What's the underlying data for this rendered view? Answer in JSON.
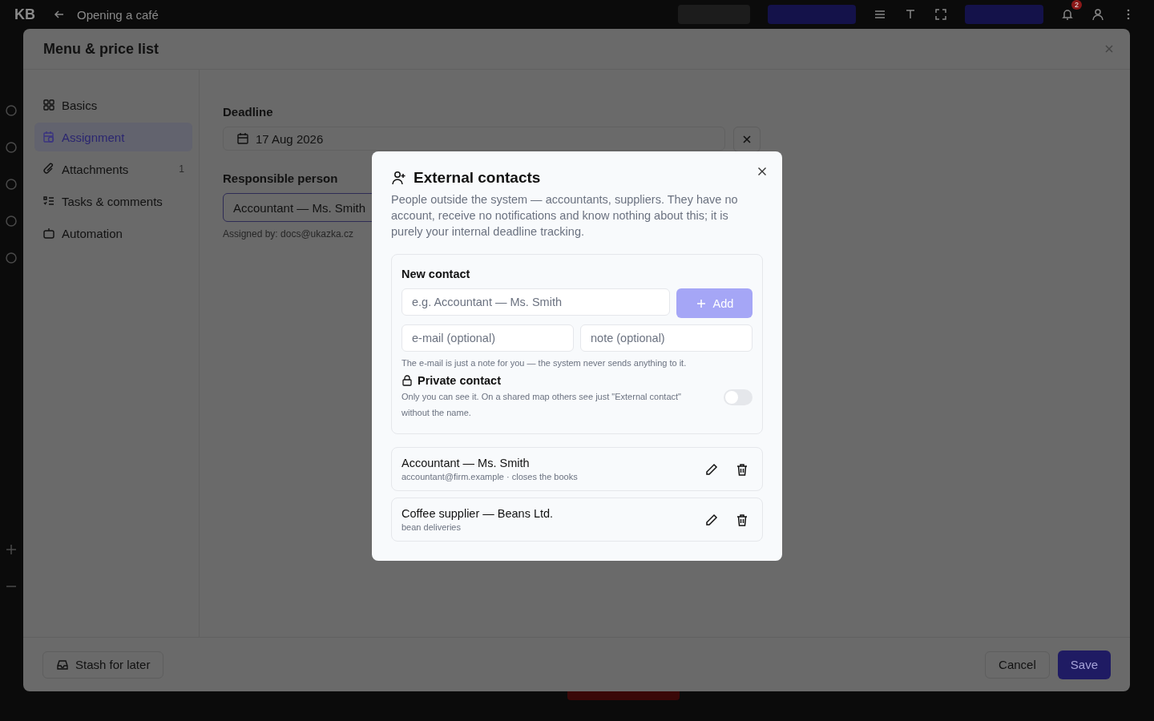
{
  "app_bar": {
    "logo": "KB",
    "title": "Opening a café",
    "notification_count": "2"
  },
  "dialog": {
    "title": "Menu & price list",
    "nav": [
      {
        "label": "Basics",
        "selected": false
      },
      {
        "label": "Assignment",
        "selected": true
      },
      {
        "label": "Attachments",
        "selected": false,
        "count": "1"
      },
      {
        "label": "Tasks & comments",
        "selected": false
      },
      {
        "label": "Automation",
        "selected": false
      }
    ],
    "deadline": {
      "label": "Deadline",
      "value": "17 Aug 2026"
    },
    "responsible": {
      "label": "Responsible person",
      "value": "Accountant — Ms. Smith",
      "note": "Assigned by: docs@ukazka.cz"
    },
    "footer": {
      "stash": "Stash for later",
      "cancel": "Cancel",
      "save": "Save"
    }
  },
  "modal": {
    "title": "External contacts",
    "description": "People outside the system — accountants, suppliers. They have no account, receive no notifications and know nothing about this; it is purely your internal deadline tracking.",
    "new_contact": {
      "heading": "New contact",
      "name_placeholder": "e.g. Accountant — Ms. Smith",
      "add": "Add",
      "add_disabled": true,
      "email_placeholder": "e-mail (optional)",
      "note_placeholder": "note (optional)",
      "hint": "The e-mail is just a note for you — the system never sends anything to it.",
      "private": {
        "label": "Private contact",
        "description": "Only you can see it. On a shared map others see just \"External contact\" without the name.",
        "on": false
      }
    },
    "contacts": [
      {
        "name": "Accountant — Ms. Smith",
        "details": "accountant@firm.example · closes the books"
      },
      {
        "name": "Coffee supplier — Beans Ltd.",
        "details": "bean deliveries"
      }
    ]
  }
}
